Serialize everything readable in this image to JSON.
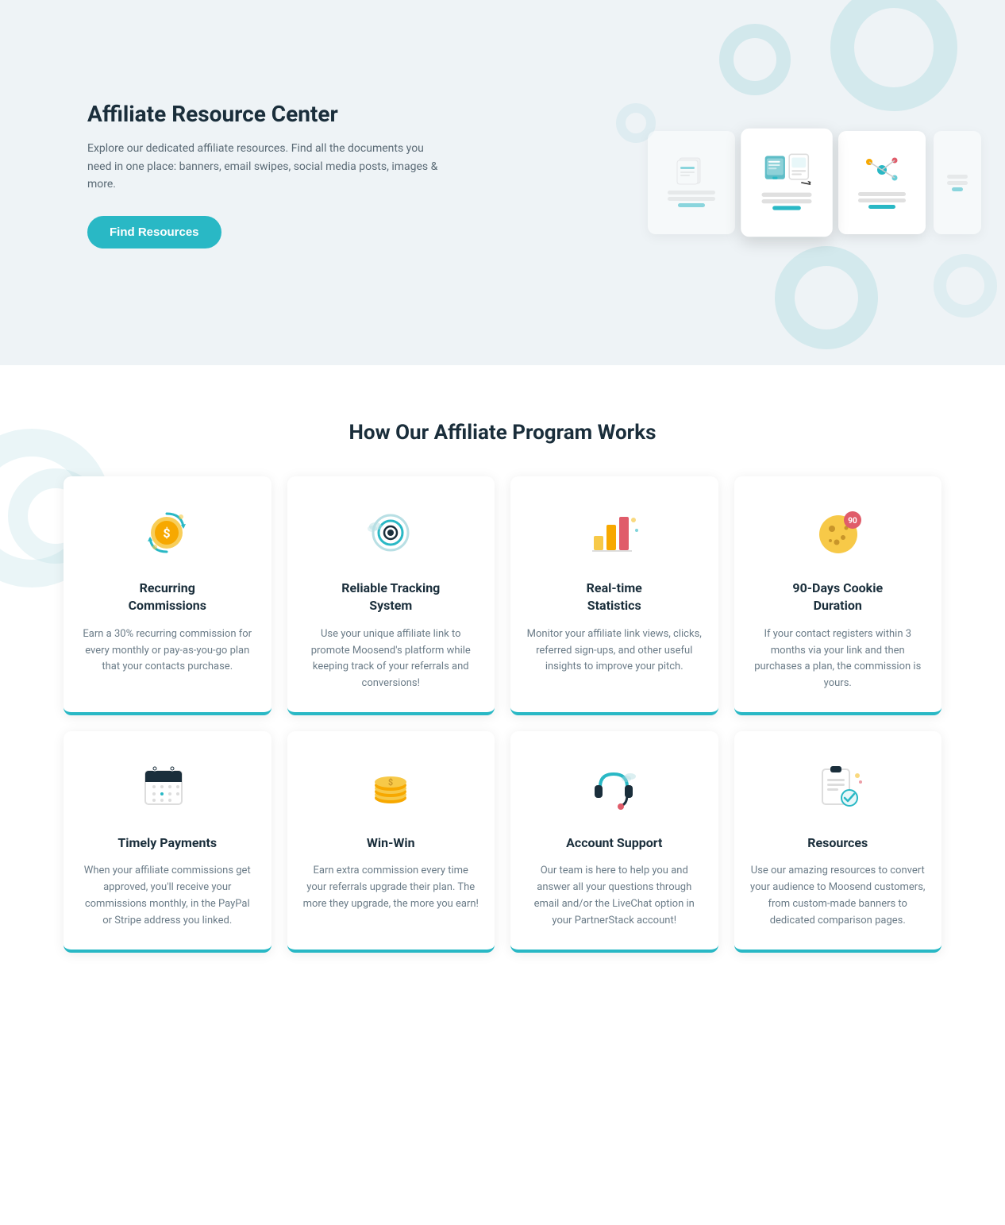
{
  "hero": {
    "title": "Affiliate Resource Center",
    "description": "Explore our dedicated affiliate resources. Find all the documents you need in one place: banners, email swipes, social media posts, images & more.",
    "button_label": "Find Resources"
  },
  "section_works": {
    "title": "How Our Affiliate Program Works",
    "cards_row1": [
      {
        "id": "recurring-commissions",
        "title": "Recurring Commissions",
        "description": "Earn a 30% recurring commission for every monthly or pay-as-you-go plan that your contacts purchase."
      },
      {
        "id": "reliable-tracking",
        "title": "Reliable Tracking System",
        "description": "Use your unique affiliate link to promote Moosend's platform while keeping track of your referrals and conversions!"
      },
      {
        "id": "realtime-statistics",
        "title": "Real-time Statistics",
        "description": "Monitor your affiliate link views, clicks, referred sign-ups, and other useful insights to improve your pitch."
      },
      {
        "id": "cookie-duration",
        "title": "90-Days Cookie Duration",
        "description": "If your contact registers within 3 months via your link and then purchases a plan, the commission is yours."
      }
    ],
    "cards_row2": [
      {
        "id": "timely-payments",
        "title": "Timely Payments",
        "description": "When your affiliate commissions get approved, you'll receive your commissions monthly, in the PayPal or Stripe address you linked."
      },
      {
        "id": "win-win",
        "title": "Win-Win",
        "description": "Earn extra commission every time your referrals upgrade their plan. The more they upgrade, the more you earn!"
      },
      {
        "id": "account-support",
        "title": "Account Support",
        "description": "Our team is here to help you and answer all your questions through email and/or the LiveChat option in your PartnerStack account!"
      },
      {
        "id": "resources",
        "title": "Resources",
        "description": "Use our amazing resources to convert your audience to Moosend customers, from custom-made banners to dedicated comparison pages."
      }
    ]
  }
}
